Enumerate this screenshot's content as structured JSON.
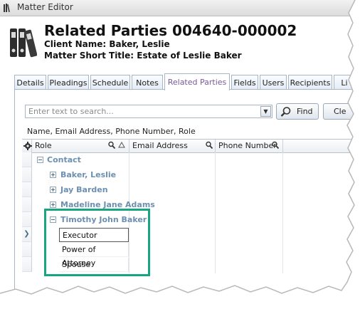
{
  "window": {
    "title": "Matter Editor"
  },
  "header": {
    "title": "Related Parties 004640-000002",
    "client_name": "Client Name: Baker, Leslie",
    "matter_short_title": "Matter Short Title: Estate of Leslie Baker"
  },
  "tabs": [
    {
      "label": "Details"
    },
    {
      "label": "Pleadings"
    },
    {
      "label": "Schedule"
    },
    {
      "label": "Notes"
    },
    {
      "label": "Related Parties",
      "active": true
    },
    {
      "label": "Fields"
    },
    {
      "label": "Users"
    },
    {
      "label": "Recipients"
    },
    {
      "label": "Li"
    }
  ],
  "search": {
    "placeholder": "Enter text to search...",
    "find_label": "Find",
    "clear_label": "Cle"
  },
  "fields_label": "Name, Email Address, Phone Number, Role",
  "grid": {
    "columns": [
      "Role",
      "Email Address",
      "Phone Number"
    ],
    "group_label": "Contact",
    "parties": [
      {
        "name": "Baker, Leslie",
        "expanded": false
      },
      {
        "name": "Jay Barden",
        "expanded": false
      },
      {
        "name": "Madeline Jane Adams",
        "expanded": false
      },
      {
        "name": "Timothy John Baker",
        "expanded": true,
        "roles": [
          "Executor",
          "Power of Attorney",
          "Spouse"
        ]
      }
    ]
  },
  "colors": {
    "highlight": "#18a582",
    "group_text": "#6d8fb0",
    "active_tab_text": "#7a5a9a"
  }
}
